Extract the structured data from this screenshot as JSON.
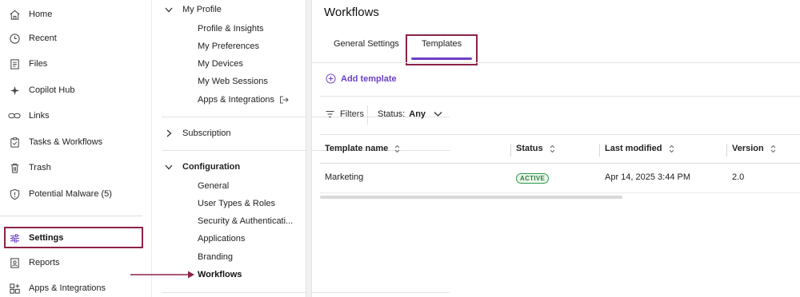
{
  "colors": {
    "accent": "#6b3fc7",
    "annotation": "#8b2346",
    "active_badge": "#2e9a4a"
  },
  "leftnav": {
    "items": [
      {
        "label": "Home",
        "icon": "home-icon"
      },
      {
        "label": "Recent",
        "icon": "clock-icon"
      },
      {
        "label": "Files",
        "icon": "file-icon"
      },
      {
        "label": "Copilot Hub",
        "icon": "sparkle-icon"
      },
      {
        "label": "Links",
        "icon": "link-icon"
      },
      {
        "label": "Tasks & Workflows",
        "icon": "clipboard-icon"
      },
      {
        "label": "Trash",
        "icon": "trash-icon"
      },
      {
        "label": "Potential Malware (5)",
        "icon": "shield-warning-icon"
      },
      {
        "label": "Settings",
        "icon": "sliders-icon"
      },
      {
        "label": "Reports",
        "icon": "report-icon"
      },
      {
        "label": "Apps & Integrations",
        "icon": "apps-grid-icon"
      }
    ]
  },
  "submenu": {
    "my_profile": {
      "label": "My Profile",
      "items": [
        "Profile & Insights",
        "My Preferences",
        "My Devices",
        "My Web Sessions",
        "Apps & Integrations"
      ]
    },
    "subscription": {
      "label": "Subscription"
    },
    "configuration": {
      "label": "Configuration",
      "items": [
        "General",
        "User Types & Roles",
        "Security & Authenticati...",
        "Applications",
        "Branding",
        "Workflows"
      ]
    }
  },
  "main": {
    "title": "Workflows",
    "tabs": [
      "General Settings",
      "Templates"
    ],
    "active_tab": "Templates",
    "add_template": "Add template",
    "filters_label": "Filters",
    "status_label": "Status:",
    "status_value": "Any",
    "table": {
      "columns": [
        "Template name",
        "Status",
        "Last modified",
        "Version"
      ],
      "rows": [
        {
          "name": "Marketing",
          "status": "ACTIVE",
          "modified": "Apr 14, 2025 3:44 PM",
          "version": "2.0"
        }
      ]
    }
  }
}
